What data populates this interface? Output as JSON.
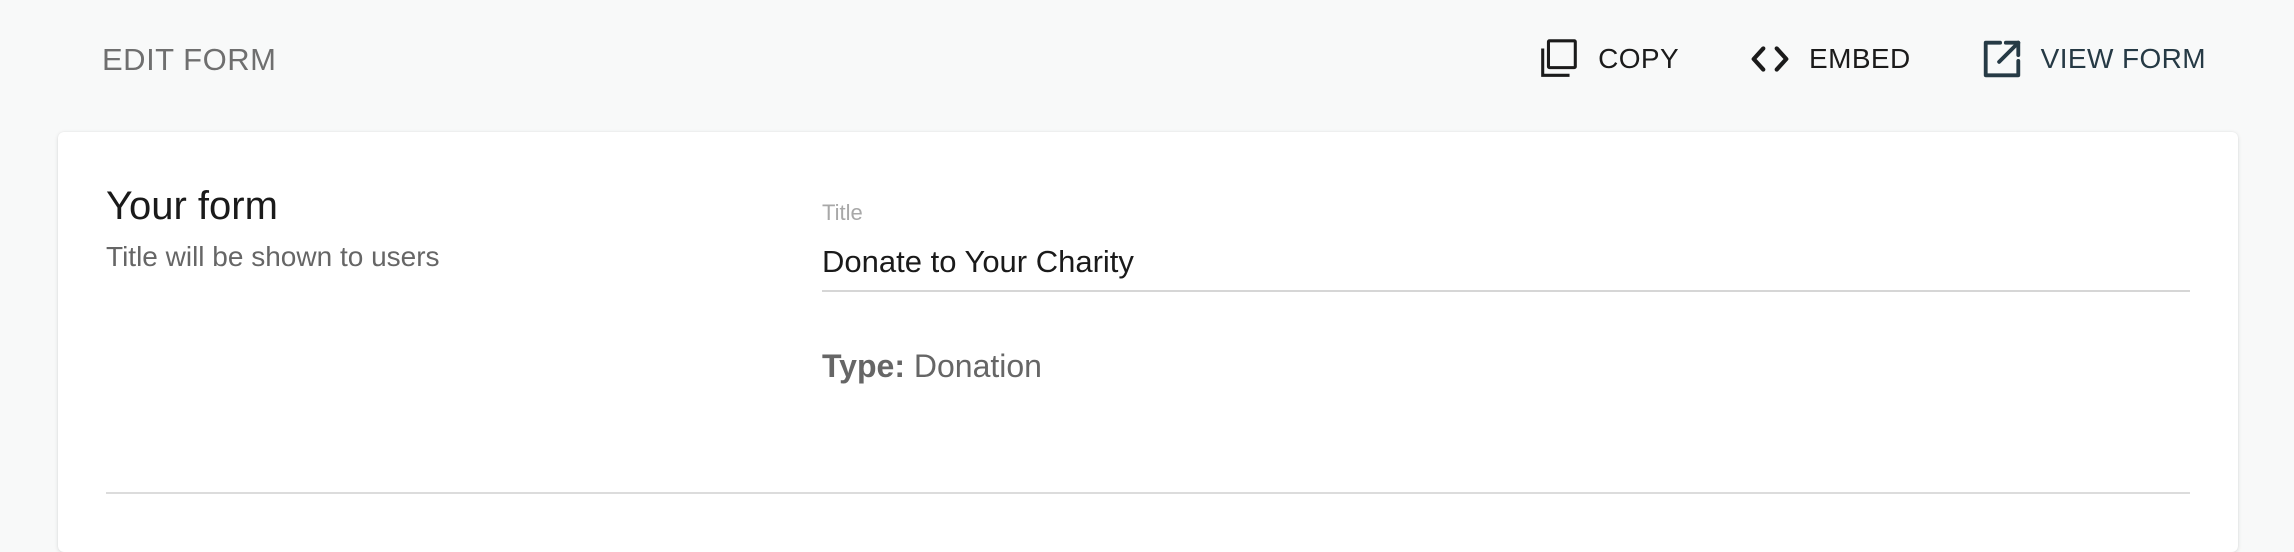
{
  "header": {
    "title": "EDIT FORM",
    "actions": [
      {
        "label": "COPY",
        "icon": "copy-icon"
      },
      {
        "label": "EMBED",
        "icon": "code-icon"
      },
      {
        "label": "VIEW FORM",
        "icon": "open-in-new-icon"
      }
    ]
  },
  "form_section": {
    "heading": "Your form",
    "subheading": "Title will be shown to users",
    "title_field": {
      "label": "Title",
      "value": "Donate to Your Charity"
    },
    "type_key": "Type:",
    "type_value": "Donation"
  },
  "colors": {
    "background": "#f8f9f9",
    "card": "#ffffff",
    "view_form_accent": "#263a45"
  }
}
